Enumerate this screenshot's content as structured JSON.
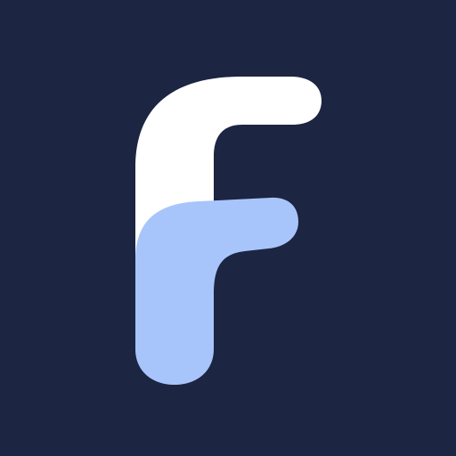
{
  "colors": {
    "background": "#1c2541",
    "letter_primary": "#ffffff",
    "letter_accent": "#a8c5fb"
  },
  "icons": {
    "logo": "letter-f-logo-icon"
  }
}
